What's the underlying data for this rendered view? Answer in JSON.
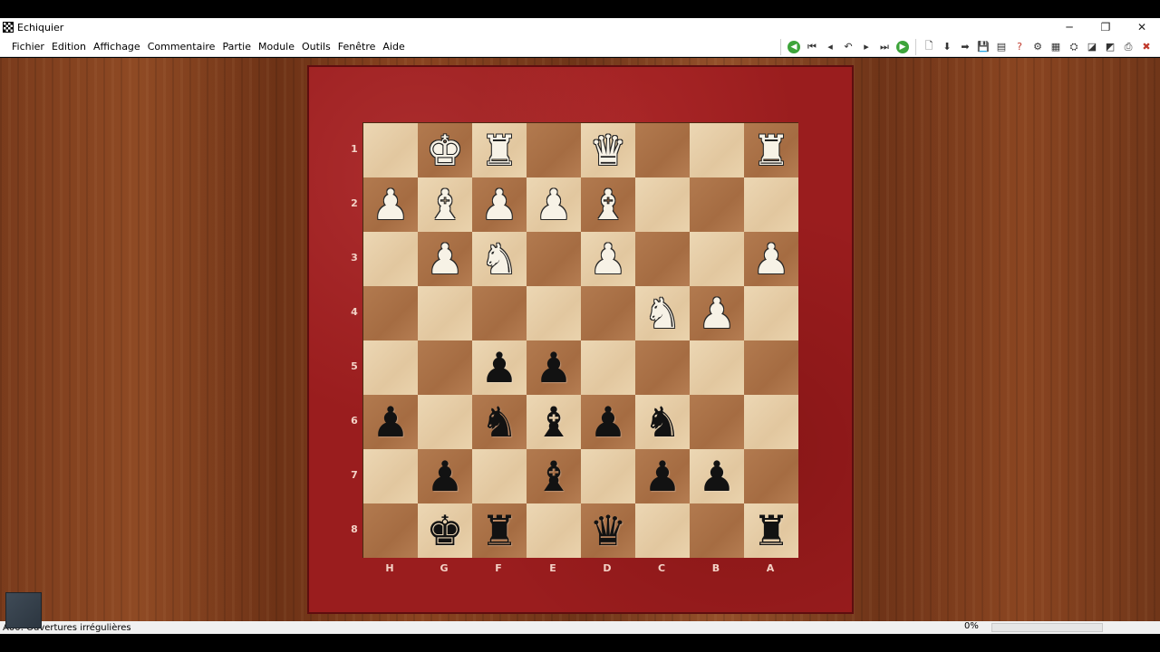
{
  "window": {
    "title": "Echiquier",
    "minimize": "─",
    "restore": "❐",
    "close": "✕"
  },
  "menu": [
    "Fichier",
    "Edition",
    "Affichage",
    "Commentaire",
    "Partie",
    "Module",
    "Outils",
    "Fenêtre",
    "Aide"
  ],
  "toolbar": {
    "nav": [
      {
        "name": "back-green-icon",
        "glyph": "◀",
        "style": "green"
      },
      {
        "name": "first-move-icon",
        "glyph": "⏮",
        "style": ""
      },
      {
        "name": "previous-move-icon",
        "glyph": "◂",
        "style": ""
      },
      {
        "name": "undo-icon",
        "glyph": "↶",
        "style": ""
      },
      {
        "name": "next-move-icon",
        "glyph": "▸",
        "style": ""
      },
      {
        "name": "last-move-icon",
        "glyph": "⏭",
        "style": ""
      },
      {
        "name": "forward-green-icon",
        "glyph": "▶",
        "style": "green"
      }
    ],
    "tools": [
      {
        "name": "new-document-icon",
        "glyph": "🗋",
        "style": ""
      },
      {
        "name": "arrow-down-icon",
        "glyph": "⬇",
        "style": ""
      },
      {
        "name": "arrow-right-icon",
        "glyph": "➡",
        "style": ""
      },
      {
        "name": "save-icon",
        "glyph": "💾",
        "style": ""
      },
      {
        "name": "database-icon",
        "glyph": "▤",
        "style": ""
      },
      {
        "name": "help-query-icon",
        "glyph": "?",
        "style": "red"
      },
      {
        "name": "analysis-icon",
        "glyph": "⚙",
        "style": ""
      },
      {
        "name": "board-setup-icon",
        "glyph": "▦",
        "style": ""
      },
      {
        "name": "engine-icon",
        "glyph": "⛭",
        "style": ""
      },
      {
        "name": "eraser-icon",
        "glyph": "◪",
        "style": ""
      },
      {
        "name": "eraser-all-icon",
        "glyph": "◩",
        "style": ""
      },
      {
        "name": "print-icon",
        "glyph": "⎙",
        "style": ""
      },
      {
        "name": "delete-icon",
        "glyph": "✖",
        "style": "red"
      },
      {
        "name": "plus-icon",
        "glyph": "✚",
        "style": "red"
      }
    ]
  },
  "board": {
    "ranks": [
      "1",
      "2",
      "3",
      "4",
      "5",
      "6",
      "7",
      "8"
    ],
    "files": [
      "H",
      "G",
      "F",
      "E",
      "D",
      "C",
      "B",
      "A"
    ],
    "rows": [
      [
        "",
        "wK",
        "wR",
        "",
        "wQ",
        "",
        "",
        "wR"
      ],
      [
        "wP",
        "wB",
        "wP",
        "wP",
        "wB",
        "",
        "",
        ""
      ],
      [
        "",
        "wP",
        "wN",
        "",
        "wP",
        "",
        "",
        "wP"
      ],
      [
        "",
        "",
        "",
        "",
        "",
        "wN",
        "wP",
        ""
      ],
      [
        "",
        "",
        "bP",
        "bP",
        "",
        "",
        "",
        ""
      ],
      [
        "bP",
        "",
        "bN",
        "bB",
        "bP",
        "bN",
        "",
        ""
      ],
      [
        "",
        "bP",
        "",
        "bB",
        "",
        "bP",
        "bP",
        ""
      ],
      [
        "",
        "bK",
        "bR",
        "",
        "bQ",
        "",
        "",
        "bR"
      ]
    ]
  },
  "status": {
    "text": "A00: Ouvertures irrégulières",
    "percent": "0%",
    "progress": 0
  }
}
